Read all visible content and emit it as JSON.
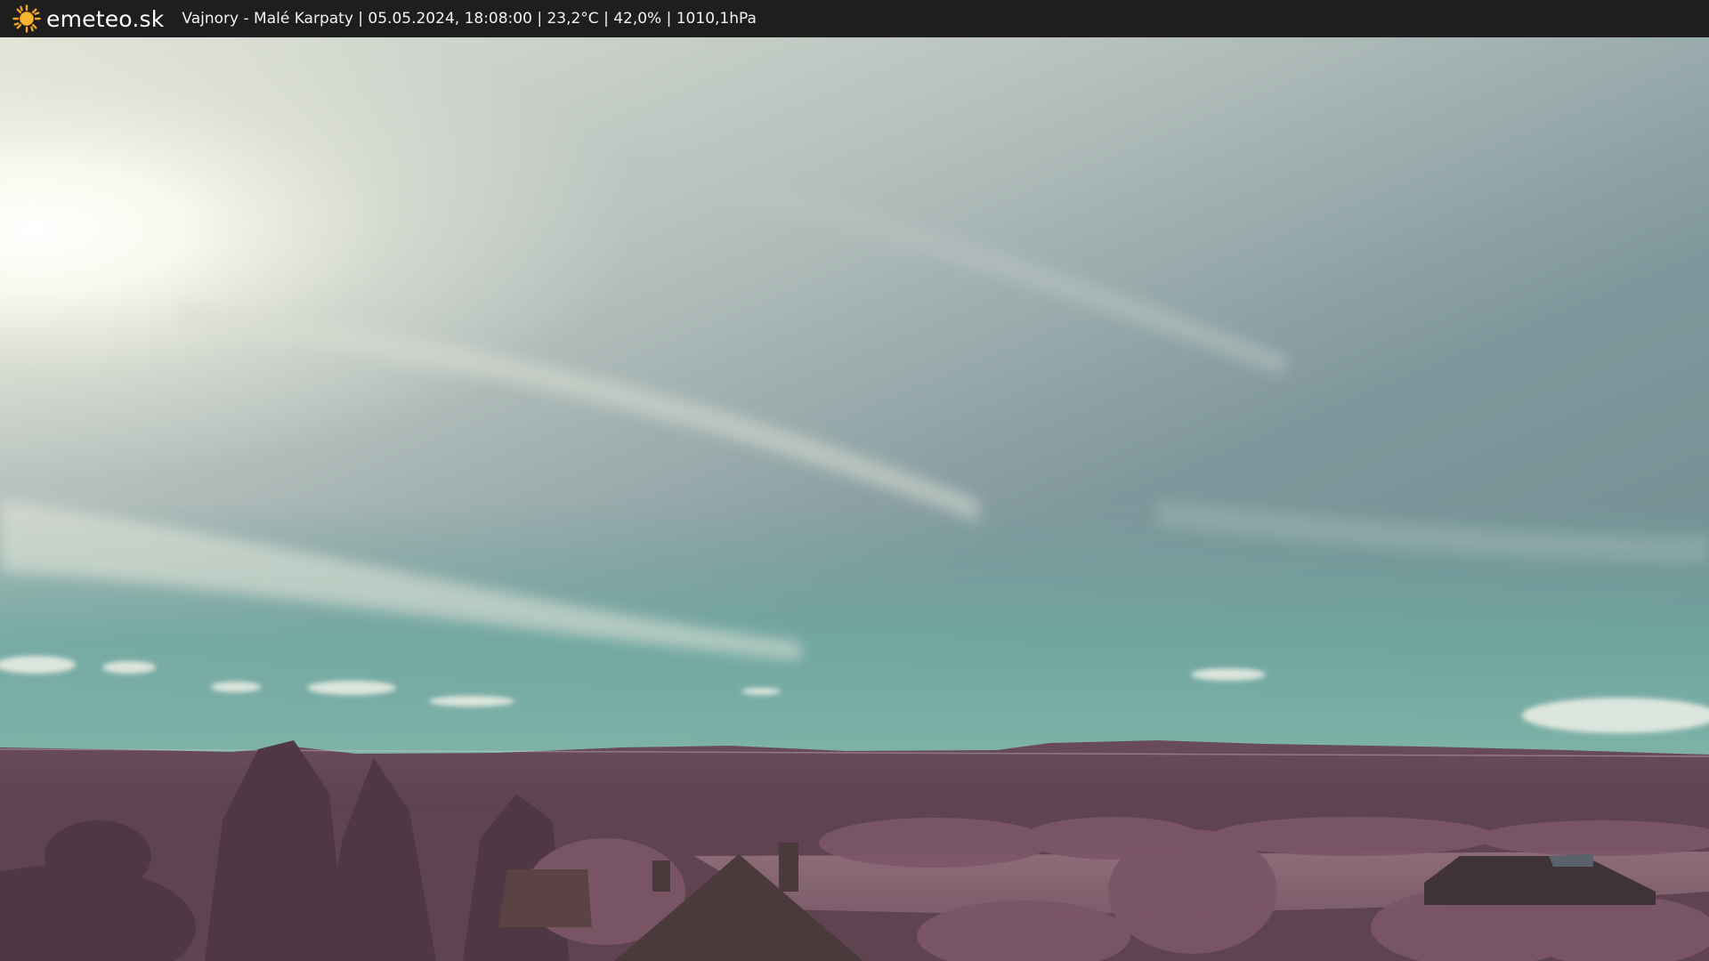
{
  "header": {
    "brand": "emeteo.sk",
    "caption": "Vajnory - Malé Karpaty | 05.05.2024, 18:08:00 | 23,2°C | 42,0% | 1010,1hPa",
    "logo_icon": "sun-icon",
    "accent_color": "#f5a623",
    "bar_color": "#1e1e1e"
  },
  "webcam": {
    "sky_colors": [
      "#e9ebe0",
      "#8aa0a4",
      "#6fa7a0"
    ],
    "land_color": "#6d4a5a"
  }
}
